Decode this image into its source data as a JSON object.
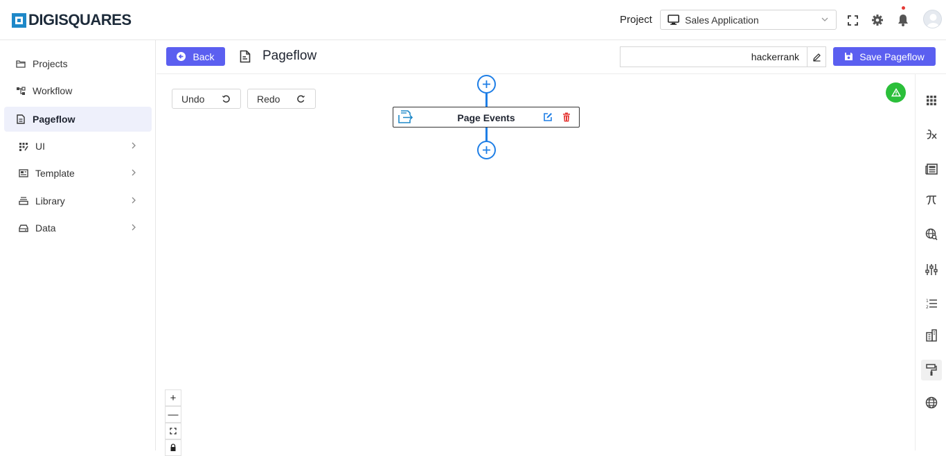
{
  "app": {
    "logo_text": "DIGISQUARES"
  },
  "header": {
    "project_label": "Project",
    "project_value": "Sales Application"
  },
  "sidebar": {
    "items": [
      {
        "label": "Projects",
        "icon": "folder-icon",
        "active": false,
        "expandable": false
      },
      {
        "label": "Workflow",
        "icon": "workflow-icon",
        "active": false,
        "expandable": false
      },
      {
        "label": "Pageflow",
        "icon": "document-icon",
        "active": true,
        "expandable": false
      },
      {
        "label": "UI",
        "icon": "ui-grid-icon",
        "active": false,
        "expandable": true
      },
      {
        "label": "Template",
        "icon": "template-icon",
        "active": false,
        "expandable": true
      },
      {
        "label": "Library",
        "icon": "library-icon",
        "active": false,
        "expandable": true
      },
      {
        "label": "Data",
        "icon": "database-icon",
        "active": false,
        "expandable": true
      }
    ]
  },
  "toolbar": {
    "back_label": "Back",
    "title": "Pageflow",
    "name_value": "hackerrank",
    "save_label": "Save Pageflow"
  },
  "canvas": {
    "undo_label": "Undo",
    "redo_label": "Redo",
    "node_label": "Page Events",
    "zoom_controls": [
      "+",
      "—"
    ]
  },
  "colors": {
    "primary": "#5b5ff0",
    "flow_blue": "#1e7ee6",
    "warning_green": "#2bbf3a",
    "delete_red": "#e53935",
    "active_nav_bg": "#eef0fb"
  },
  "rail": {
    "icons": [
      "apps-grid-icon",
      "function-icon",
      "newspaper-icon",
      "pi-icon",
      "globe-search-icon",
      "sliders-icon",
      "numbered-list-icon",
      "building-icon",
      "paint-roller-icon",
      "globe-icon"
    ]
  }
}
